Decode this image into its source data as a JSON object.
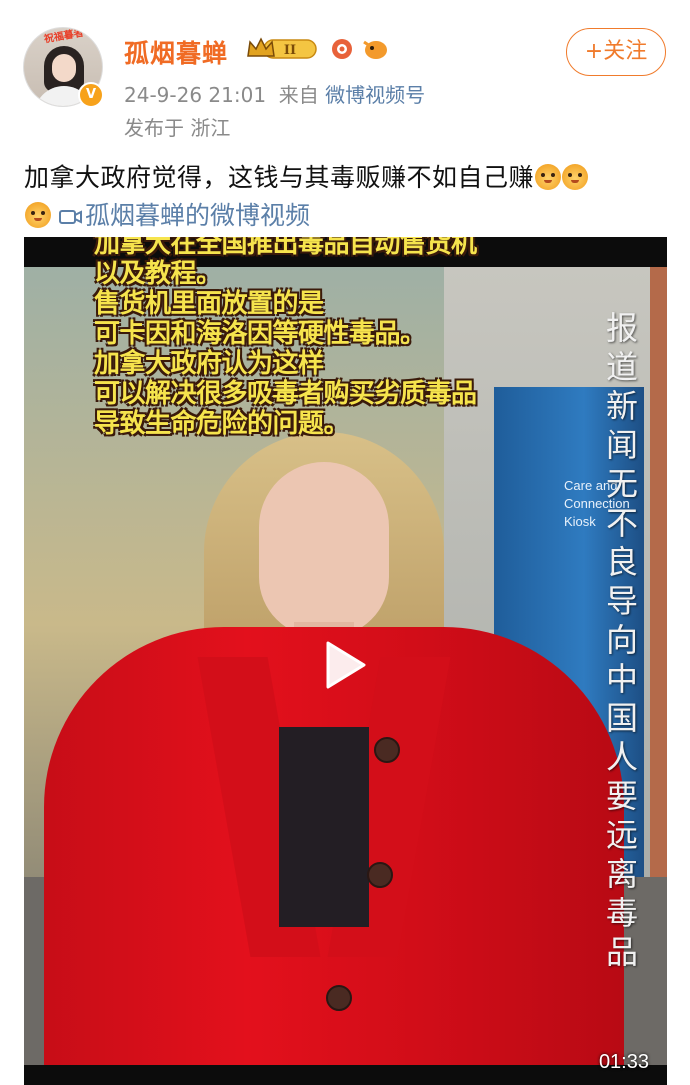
{
  "post": {
    "username": "孤烟暮蝉",
    "avatar_tag": "祝福暮者",
    "level_badge": "II",
    "timestamp": "24-9-26 21:01",
    "source_prefix": "来自",
    "source": "微博视频号",
    "location": "发布于 浙江",
    "follow_label": "+关注",
    "text": "加拿大政府觉得，这钱与其毒贩赚不如自己赚",
    "video_link": "孤烟暮蝉的微博视频",
    "icons": [
      "verified-v-icon",
      "crown-level-icon",
      "badge-icon",
      "emoji-doge-icon",
      "video-camera-icon",
      "play-icon"
    ]
  },
  "video": {
    "captions": [
      "加拿大在全国推出毒品自动售货机",
      "以及教程。",
      "售货机里面放置的是",
      "可卡因和海洛因等硬性毒品。",
      "加拿大政府认为这样",
      "可以解决很多吸毒者购买劣质毒品",
      "导致生命危险的问题。"
    ],
    "vertical_text": "报道新闻无不良导向 中国人要远离毒品",
    "kiosk_text": "Care and Connection Kiosk",
    "duration": "01:33"
  },
  "colors": {
    "username": "#f06b24",
    "link": "#5b7fa8",
    "caption": "#f6e44d",
    "coat": "#e3101c"
  }
}
